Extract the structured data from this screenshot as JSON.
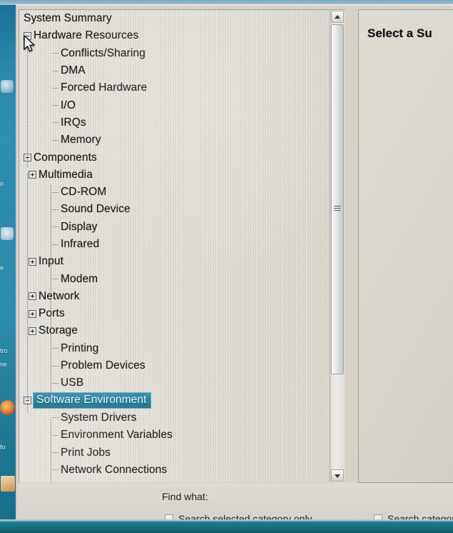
{
  "window": {
    "right_pane_title": "Select a Su"
  },
  "tree": {
    "items": [
      {
        "label": "System Summary",
        "level": 0,
        "toggle": "none",
        "selected": false
      },
      {
        "label": "Hardware Resources",
        "level": 0,
        "toggle": "minus",
        "selected": false
      },
      {
        "label": "Conflicts/Sharing",
        "level": 2,
        "toggle": "stub",
        "selected": false
      },
      {
        "label": "DMA",
        "level": 2,
        "toggle": "stub",
        "selected": false
      },
      {
        "label": "Forced Hardware",
        "level": 2,
        "toggle": "stub",
        "selected": false
      },
      {
        "label": "I/O",
        "level": 2,
        "toggle": "stub",
        "selected": false
      },
      {
        "label": "IRQs",
        "level": 2,
        "toggle": "stub",
        "selected": false
      },
      {
        "label": "Memory",
        "level": 2,
        "toggle": "stub",
        "selected": false
      },
      {
        "label": "Components",
        "level": 0,
        "toggle": "minus",
        "selected": false
      },
      {
        "label": "Multimedia",
        "level": 1,
        "toggle": "plus",
        "selected": false
      },
      {
        "label": "CD-ROM",
        "level": 2,
        "toggle": "stub",
        "selected": false
      },
      {
        "label": "Sound Device",
        "level": 2,
        "toggle": "stub",
        "selected": false
      },
      {
        "label": "Display",
        "level": 2,
        "toggle": "stub",
        "selected": false
      },
      {
        "label": "Infrared",
        "level": 2,
        "toggle": "stub",
        "selected": false
      },
      {
        "label": "Input",
        "level": 1,
        "toggle": "plus",
        "selected": false
      },
      {
        "label": "Modem",
        "level": 2,
        "toggle": "stub",
        "selected": false
      },
      {
        "label": "Network",
        "level": 1,
        "toggle": "plus",
        "selected": false
      },
      {
        "label": "Ports",
        "level": 1,
        "toggle": "plus",
        "selected": false
      },
      {
        "label": "Storage",
        "level": 1,
        "toggle": "plus",
        "selected": false
      },
      {
        "label": "Printing",
        "level": 2,
        "toggle": "stub",
        "selected": false
      },
      {
        "label": "Problem Devices",
        "level": 2,
        "toggle": "stub",
        "selected": false
      },
      {
        "label": "USB",
        "level": 2,
        "toggle": "stub",
        "selected": false
      },
      {
        "label": "Software Environment",
        "level": 0,
        "toggle": "minus",
        "selected": true
      },
      {
        "label": "System Drivers",
        "level": 2,
        "toggle": "stub",
        "selected": false
      },
      {
        "label": "Environment Variables",
        "level": 2,
        "toggle": "stub",
        "selected": false
      },
      {
        "label": "Print Jobs",
        "level": 2,
        "toggle": "stub",
        "selected": false
      },
      {
        "label": "Network Connections",
        "level": 2,
        "toggle": "stub",
        "selected": false
      }
    ],
    "selection_color": "#1b7f9f"
  },
  "find_bar": {
    "find_label": "Find what:",
    "checkbox_left_label": "Search selected category only",
    "checkbox_right_label": "Search category",
    "checkbox_left_checked": false,
    "checkbox_right_checked": false
  },
  "scrollbar": {
    "up_arrow": "scroll-up-arrow",
    "down_arrow": "scroll-down-arrow"
  },
  "desktop": {
    "text_fragments": {
      "o": "o",
      "e": "e",
      "tro": "tro",
      "ne": "ne",
      "fo": "fo"
    }
  }
}
